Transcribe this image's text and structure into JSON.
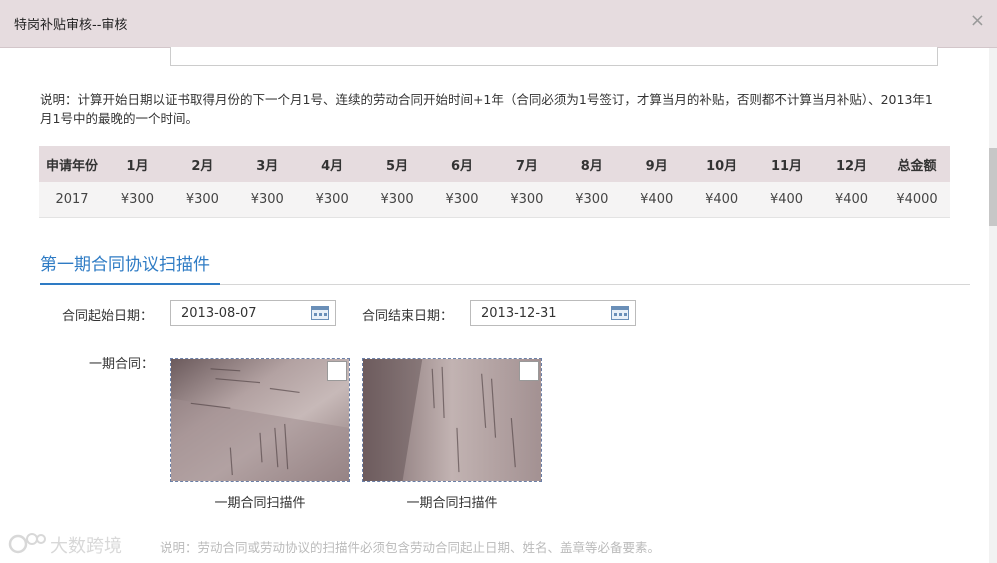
{
  "dialog": {
    "title": "特岗补贴审核--审核",
    "close_glyph": "×"
  },
  "note": "说明：计算开始日期以证书取得月份的下一个月1号、连续的劳动合同开始时间+1年（合同必须为1号签订，才算当月的补贴，否则都不计算当月补贴）、2013年1月1号中的最晚的一个时间。",
  "table": {
    "headers": [
      "申请年份",
      "1月",
      "2月",
      "3月",
      "4月",
      "5月",
      "6月",
      "7月",
      "8月",
      "9月",
      "10月",
      "11月",
      "12月",
      "总金额"
    ],
    "rows": [
      [
        "2017",
        "¥300",
        "¥300",
        "¥300",
        "¥300",
        "¥300",
        "¥300",
        "¥300",
        "¥300",
        "¥400",
        "¥400",
        "¥400",
        "¥400",
        "¥4000"
      ]
    ]
  },
  "section": {
    "title": "第一期合同协议扫描件",
    "start_label": "合同起始日期：",
    "start_value": "2013-08-07",
    "end_label": "合同结束日期：",
    "end_value": "2013-12-31",
    "contract_label": "一期合同：",
    "images": [
      {
        "caption": "一期合同扫描件"
      },
      {
        "caption": "一期合同扫描件"
      }
    ]
  },
  "watermark_text": "大数跨境",
  "bottom_note": "说明：劳动合同或劳动协议的扫描件必须包含劳动合同起止日期、姓名、盖章等必备要素。",
  "colors": {
    "header_bg": "#e6dcdf",
    "accent": "#2e7bc4"
  }
}
